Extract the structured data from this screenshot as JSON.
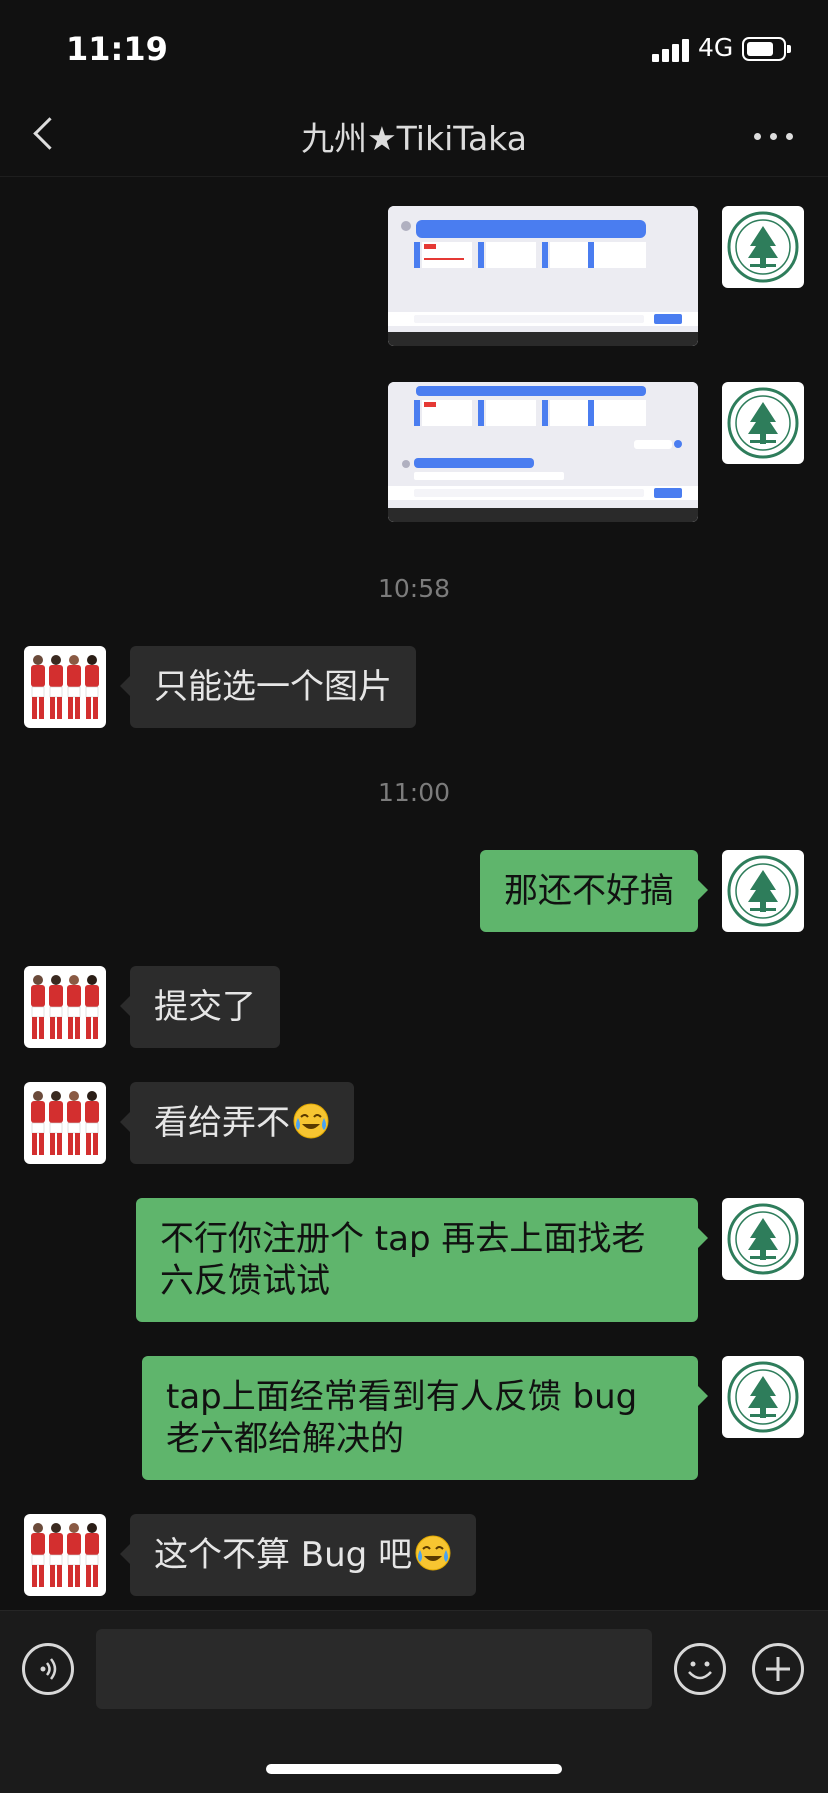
{
  "status_bar": {
    "time": "11:19",
    "network": "4G",
    "battery_level": 0.75
  },
  "header": {
    "title": "九州★TikiTaka",
    "back_icon": "chevron-left-icon",
    "more_icon": "ellipsis-icon"
  },
  "messages": [
    {
      "type": "image",
      "from": "me"
    },
    {
      "type": "image",
      "from": "me"
    },
    {
      "type": "time",
      "text": "10:58"
    },
    {
      "type": "text",
      "from": "other",
      "text": "只能选一个图片"
    },
    {
      "type": "time",
      "text": "11:00"
    },
    {
      "type": "text",
      "from": "me",
      "text": "那还不好搞"
    },
    {
      "type": "text",
      "from": "other",
      "text": "提交了"
    },
    {
      "type": "text",
      "from": "other",
      "text": "看给弄不",
      "emoji": "crying-laughing-emoji"
    },
    {
      "type": "text",
      "from": "me",
      "text": "不行你注册个 tap 再去上面找老六反馈试试"
    },
    {
      "type": "text",
      "from": "me",
      "text": "tap上面经常看到有人反馈 bug 老六都给解决的"
    },
    {
      "type": "text",
      "from": "other",
      "text": "这个不算 Bug 吧",
      "emoji": "crying-laughing-emoji"
    }
  ],
  "input_bar": {
    "placeholder": "",
    "voice_icon": "voice-icon",
    "emoji_icon": "smiley-icon",
    "plus_icon": "plus-icon"
  },
  "colors": {
    "background": "#111111",
    "bubble_in": "#2c2c2c",
    "bubble_out": "#5fb56c",
    "avatar_me_green": "#2e7d5b",
    "jersey_red": "#d32f2f"
  }
}
